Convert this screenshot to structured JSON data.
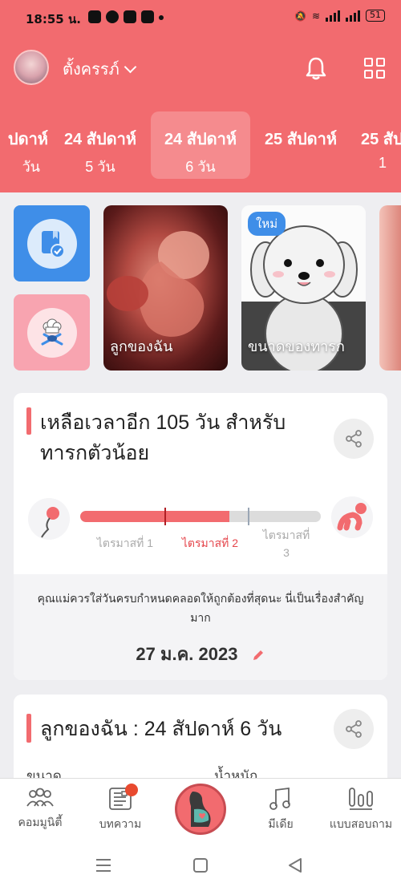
{
  "status_bar": {
    "time": "18:55 น.",
    "battery": "51"
  },
  "header": {
    "username": "ตั้งครรภ์",
    "weeks": [
      {
        "week": "ปดาห์",
        "days": "วัน"
      },
      {
        "week": "24 สัปดาห์",
        "days": "5 วัน"
      },
      {
        "week": "24 สัปดาห์",
        "days": "6 วัน",
        "active": true
      },
      {
        "week": "25 สัปดาห์",
        "days": ""
      },
      {
        "week": "25 สัป",
        "days": "1"
      }
    ]
  },
  "tiles": {
    "baby_card_caption": "ลูกของฉัน",
    "size_card_caption": "ขนาดของทารก",
    "new_badge": "ใหม่"
  },
  "countdown": {
    "title_line1": "เหลือเวลาอีก 105 วัน สำหรับ",
    "title_line2": "ทารกตัวน้อย",
    "progress_fraction": 0.62,
    "trimesters": [
      "ไตรมาสที่ 1",
      "ไตรมาสที่ 2",
      "ไตรมาสที่",
      "3"
    ],
    "note": "คุณแม่ควรใส่วันครบกำหนดคลอดให้ถูกต้องที่สุดนะ นี่เป็นเรื่องสำคัญมาก",
    "due_date": "27 ม.ค. 2023"
  },
  "baby_card": {
    "title": "ลูกของฉัน : 24 สัปดาห์ 6  วัน",
    "size_label": "ขนาด",
    "weight_label": "น้ำหนัก"
  },
  "bottom_nav": {
    "community": "คอมมูนิตี้",
    "articles": "บทความ",
    "media": "มีเดีย",
    "quiz": "แบบสอบถาม"
  },
  "colors": {
    "accent": "#f26b6f",
    "blue_tile": "#3f8ee8",
    "pink_tile": "#f8a4b0"
  }
}
